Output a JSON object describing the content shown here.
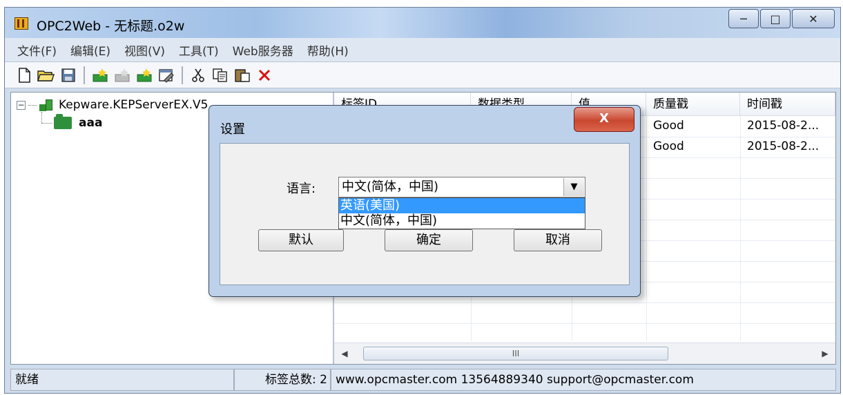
{
  "window": {
    "title": "OPC2Web - 无标题.o2w",
    "controls": {
      "minimize": "─",
      "maximize": "□",
      "close": "✕"
    }
  },
  "menu": [
    "文件(F)",
    "编辑(E)",
    "视图(V)",
    "工具(T)",
    "Web服务器",
    "帮助(H)"
  ],
  "toolbar": {
    "icons": [
      "new-file-icon",
      "open-folder-icon",
      "save-icon",
      "add-server-icon",
      "add-group-icon",
      "add-tag-icon",
      "properties-icon",
      "cut-icon",
      "copy-icon",
      "paste-icon",
      "delete-icon"
    ]
  },
  "tree": {
    "root": {
      "label": "Kepware.KEPServerEX.V5",
      "expander": "−"
    },
    "child": {
      "label": "aaa"
    }
  },
  "table": {
    "columns": [
      "标签ID",
      "数据类型",
      "值",
      "质量戳",
      "时间戳"
    ],
    "rows": [
      {
        "quality": "Good",
        "timestamp": "2015-08-2..."
      },
      {
        "quality": "Good",
        "timestamp": "2015-08-2..."
      }
    ],
    "scroll_left": "◀",
    "scroll_right": "▶",
    "scroll_thumb": "III"
  },
  "status": {
    "ready": "就绪",
    "tag_count": "标签总数: 2",
    "contact": "www.opcmaster.com 13564889340 support@opcmaster.com"
  },
  "dialog": {
    "title": "设置",
    "close": "X",
    "language_label": "语言:",
    "selected_value": "中文(简体，中国)",
    "options": [
      "英语(美国)",
      "中文(简体，中国)"
    ],
    "dropdown_arrow": "▼",
    "buttons": {
      "default": "默认",
      "ok": "确定",
      "cancel": "取消"
    }
  }
}
